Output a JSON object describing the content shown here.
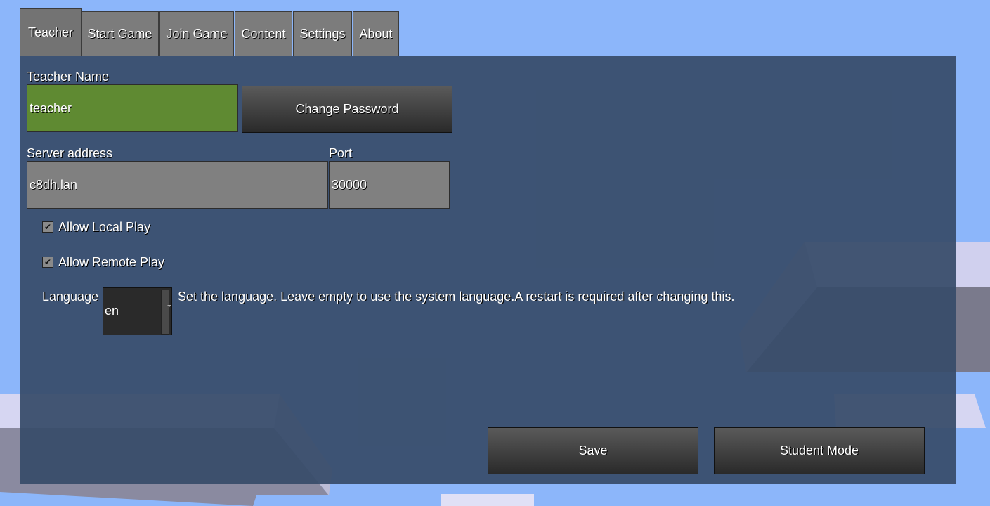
{
  "tabs": [
    {
      "label": "Teacher",
      "active": true
    },
    {
      "label": "Start Game"
    },
    {
      "label": "Join Game"
    },
    {
      "label": "Content"
    },
    {
      "label": "Settings"
    },
    {
      "label": "About"
    }
  ],
  "teacher_name": {
    "label": "Teacher Name",
    "value": "teacher"
  },
  "change_password_label": "Change Password",
  "server": {
    "address_label": "Server address",
    "address_value": "c8dh.lan",
    "port_label": "Port",
    "port_value": "30000"
  },
  "checkboxes": [
    {
      "label": "Allow Local Play",
      "checked": true
    },
    {
      "label": "Allow Remote Play",
      "checked": true
    }
  ],
  "language": {
    "label": "Language",
    "value": "en",
    "description": "Set the language. Leave empty to use the system language.A restart is required after changing this."
  },
  "buttons": {
    "save": "Save",
    "student_mode": "Student Mode"
  },
  "colors": {
    "sky": "#8cb6fa",
    "panel": "#374b69",
    "name_field": "#5f8a32",
    "field": "#808080"
  }
}
